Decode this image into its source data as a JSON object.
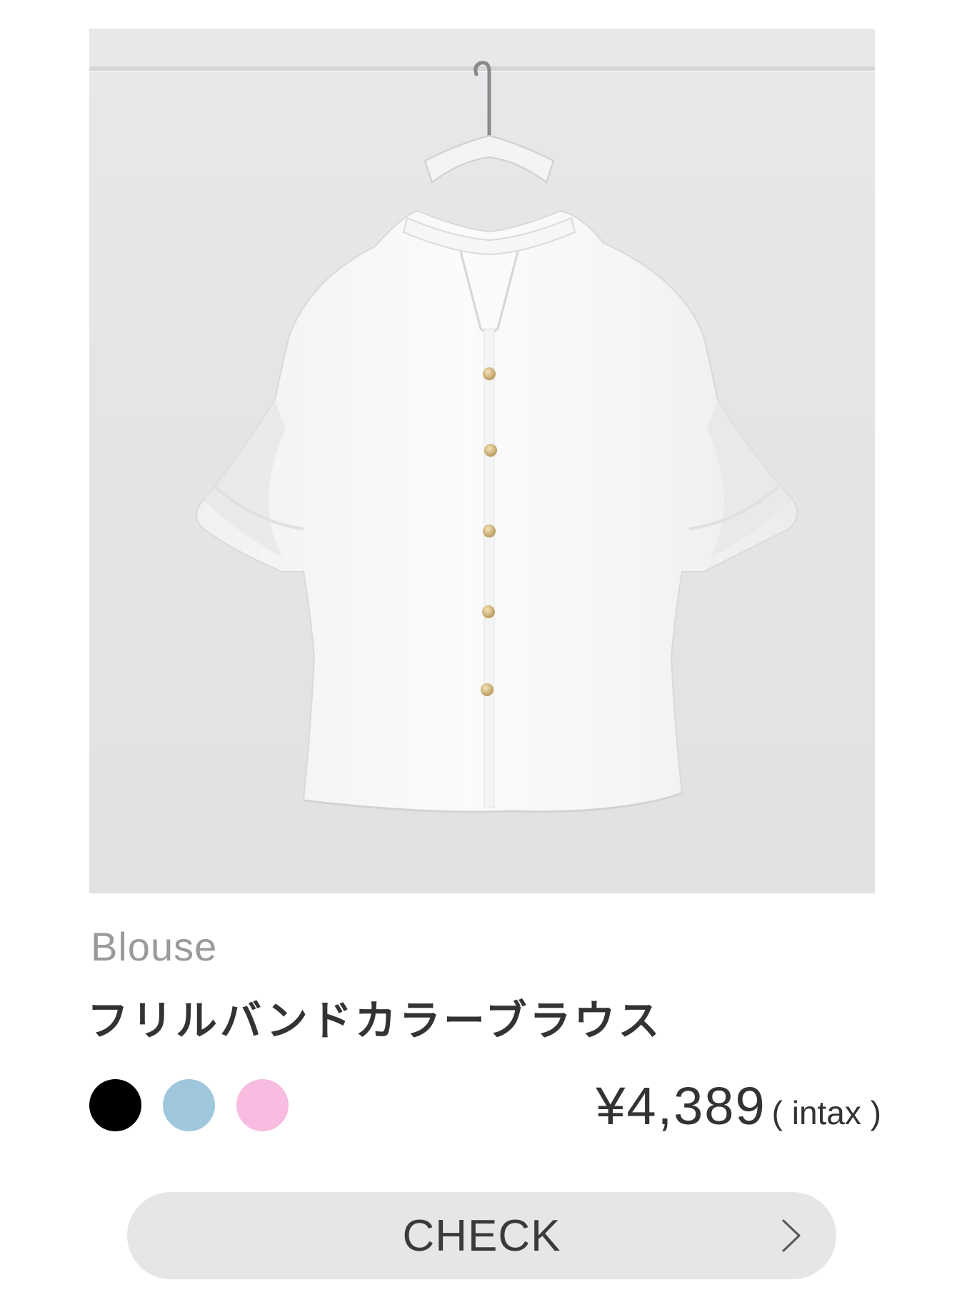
{
  "product": {
    "image_alt": "",
    "category": "Blouse",
    "name": "フリルバンドカラーブラウス",
    "price": "¥4,389",
    "price_note": "( intax )",
    "colors": [
      {
        "name": "black",
        "hex": "#000000"
      },
      {
        "name": "light-blue",
        "hex": "#9fc7dc"
      },
      {
        "name": "pink",
        "hex": "#f7bcdf"
      }
    ]
  },
  "cta": {
    "label": "CHECK",
    "icon": "chevron-right-icon"
  }
}
